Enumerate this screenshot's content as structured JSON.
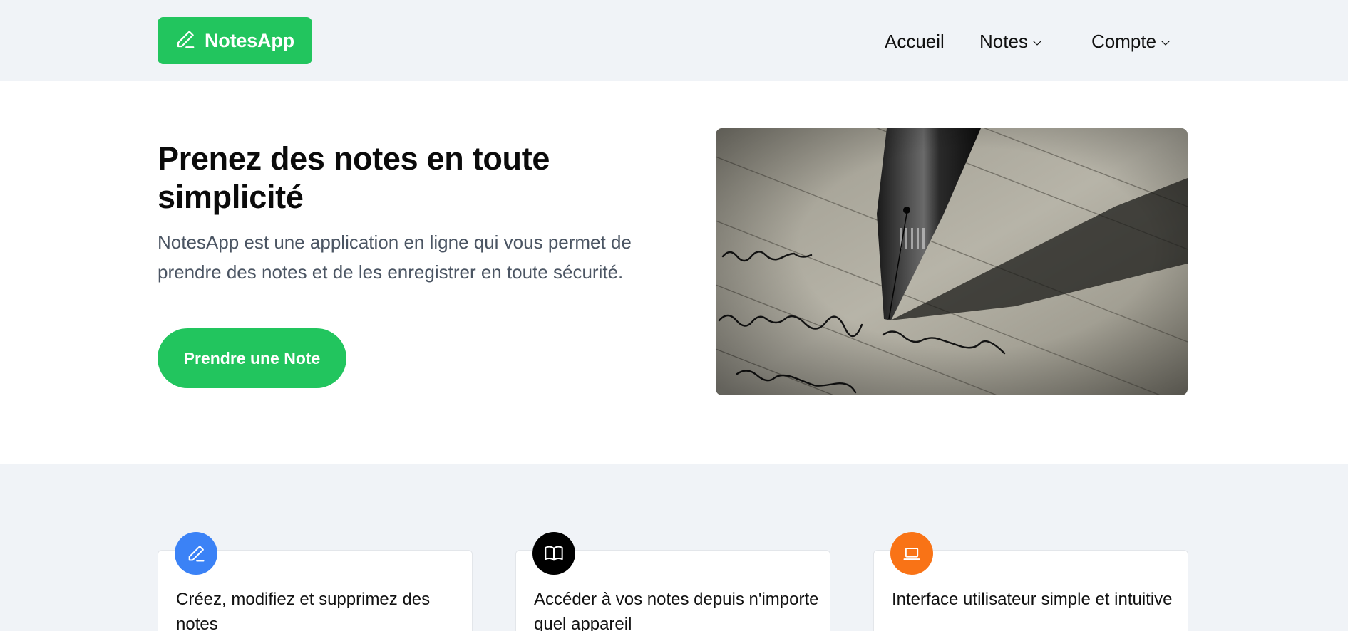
{
  "header": {
    "logo_text": "NotesApp",
    "nav": {
      "home": "Accueil",
      "notes": "Notes",
      "account": "Compte"
    }
  },
  "hero": {
    "title": "Prenez des notes en toute simplicité",
    "description": "NotesApp est une application en ligne qui vous permet de prendre des notes et de les enregistrer en toute sécurité.",
    "cta": "Prendre une Note"
  },
  "features": [
    {
      "icon": "pencil-icon",
      "color": "#3b82f6",
      "text": "Créez, modifiez et supprimez des notes"
    },
    {
      "icon": "book-open-icon",
      "color": "#000000",
      "text": "Accéder à vos notes depuis n'importe quel appareil"
    },
    {
      "icon": "laptop-icon",
      "color": "#f97316",
      "text": "Interface utilisateur simple et intuitive"
    }
  ],
  "colors": {
    "brand": "#22c55e",
    "page_bg": "#f0f3f7",
    "text_muted": "#4b5563"
  }
}
